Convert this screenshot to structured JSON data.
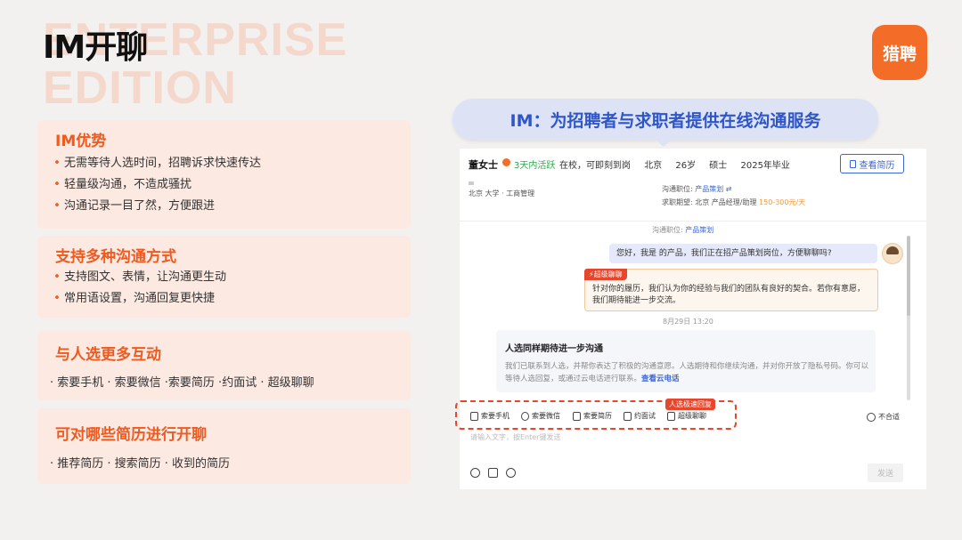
{
  "header": {
    "watermark_line1": "ENTERPRISE",
    "watermark_line2": "EDITION",
    "title": "IM开聊",
    "logo_text": "猎聘"
  },
  "cards": [
    {
      "title": "IM优势",
      "items": [
        "无需等待人选时间，招聘诉求快速传达",
        "轻量级沟通，不造成骚扰",
        "沟通记录一目了然，方便跟进"
      ]
    },
    {
      "title": "支持多种沟通方式",
      "items": [
        "支持图文、表情，让沟通更生动",
        "常用语设置，沟通回复更快捷"
      ]
    },
    {
      "title": "与人选更多互动",
      "line": "· 索要手机 · 索要微信 ·索要简历 ·约面试 · 超级聊聊"
    },
    {
      "title": "可对哪些简历进行开聊",
      "line": "· 推荐简历 · 搜索简历 · 收到的简历"
    }
  ],
  "bubble": {
    "text": "IM：为招聘者与求职者提供在线沟通服务"
  },
  "chat": {
    "candidate": {
      "name": "董女士",
      "active": "3天内活跃",
      "status": "在校，可即刻到岗",
      "city": "北京",
      "age": "26岁",
      "degree": "硕士",
      "grad": "2025年毕业",
      "edu_line": "北京     大学 · 工商管理"
    },
    "view_resume": "查看简历",
    "position": {
      "label": "沟通职位:",
      "value": "产品策划",
      "switch": "⇄",
      "expect_label": "求职期望:",
      "expect_city": "北京",
      "expect_role": "产品经理/助理",
      "salary": "150-300元/天"
    },
    "position_note_label": "沟通职位:",
    "position_note_value": "产品策划",
    "msg_out": "您好，我是            的产品，我们正在招产品策划岗位，方便聊聊吗?",
    "super_tag": "⚡超级聊聊",
    "super_text": "针对你的履历，我们认为你的经验与我们的团队有良好的契合。若你有意愿，我们期待能进一步交流。",
    "timestamp": "8月29日 13:20",
    "card_title": "人选同样期待进一步沟通",
    "card_text": "我们已联系到人选，并帮你表达了积极的沟通意愿。人选期待和你继续沟通，并对你开放了隐私号码。你可以等待人选回复，或通过云电话进行联系。",
    "card_link": "查看云电话",
    "tools": [
      "索要手机",
      "索要微信",
      "索要简历",
      "约面试",
      "超级聊聊"
    ],
    "fast_badge": "人选极速回复",
    "reject": "不合适",
    "input_placeholder": "请输入文字，按Enter键发送",
    "send": "发送"
  },
  "colors": {
    "accent": "#ee5a1f",
    "brand": "#f36c28",
    "link": "#3b66d6"
  }
}
